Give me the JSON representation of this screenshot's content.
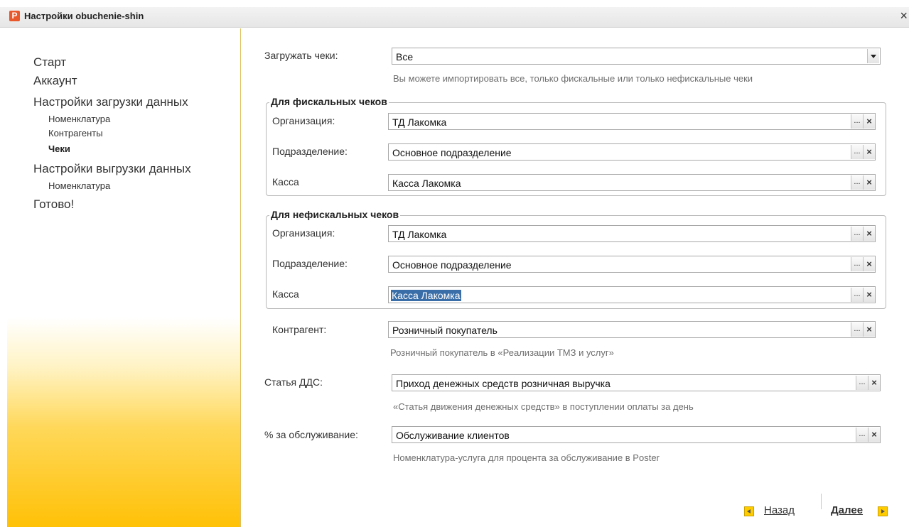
{
  "window": {
    "title": "Настройки obuchenie-shin",
    "icon_letter": "P",
    "close_glyph": "×"
  },
  "sidebar": {
    "items": [
      {
        "label": "Старт"
      },
      {
        "label": "Аккаунт"
      },
      {
        "label": "Настройки загрузки данных"
      },
      {
        "label": "Номенклатура"
      },
      {
        "label": "Контрагенты"
      },
      {
        "label": "Чеки"
      },
      {
        "label": "Настройки выгрузки данных"
      },
      {
        "label": "Номенклатура"
      },
      {
        "label": "Готово!"
      }
    ],
    "active": "Чеки"
  },
  "form": {
    "load_receipts": {
      "label": "Загружать чеки:",
      "value": "Все",
      "hint": "Вы можете импортировать все, только фискальные или только нефискальные чеки"
    },
    "fiscal": {
      "legend": "Для фискальных чеков",
      "organization": {
        "label": "Организация:",
        "value": "ТД Лакомка"
      },
      "department": {
        "label": "Подразделение:",
        "value": "Основное подразделение"
      },
      "cash": {
        "label": "Касса",
        "value": "Касса Лакомка"
      }
    },
    "nonfiscal": {
      "legend": "Для нефискальных чеков",
      "organization": {
        "label": "Организация:",
        "value": "ТД Лакомка"
      },
      "department": {
        "label": "Подразделение:",
        "value": "Основное подразделение"
      },
      "cash": {
        "label": "Касса",
        "value": "Касса Лакомка"
      }
    },
    "counterparty": {
      "label": "Контрагент:",
      "value": "Розничный покупатель",
      "hint": "Розничный покупатель в «Реализации ТМЗ и услуг»"
    },
    "dds_article": {
      "label": "Статья ДДС:",
      "value": "Приход денежных средств розничная выручка",
      "hint": "«Статья движения денежных средств» в поступлении оплаты за день"
    },
    "service_percent": {
      "label": "% за обслуживание:",
      "value": "Обслуживание клиентов",
      "hint": "Номенклатура-услуга для процента за обслуживание в Poster"
    },
    "select_glyph": "...",
    "clear_glyph": "×"
  },
  "footer": {
    "back_label": "Назад",
    "next_label": "Далее"
  },
  "colors": {
    "sidebar_gradient_bottom": "#ffc107",
    "selection": "#3a6ea8",
    "arrow_button": "#ffcc00"
  }
}
